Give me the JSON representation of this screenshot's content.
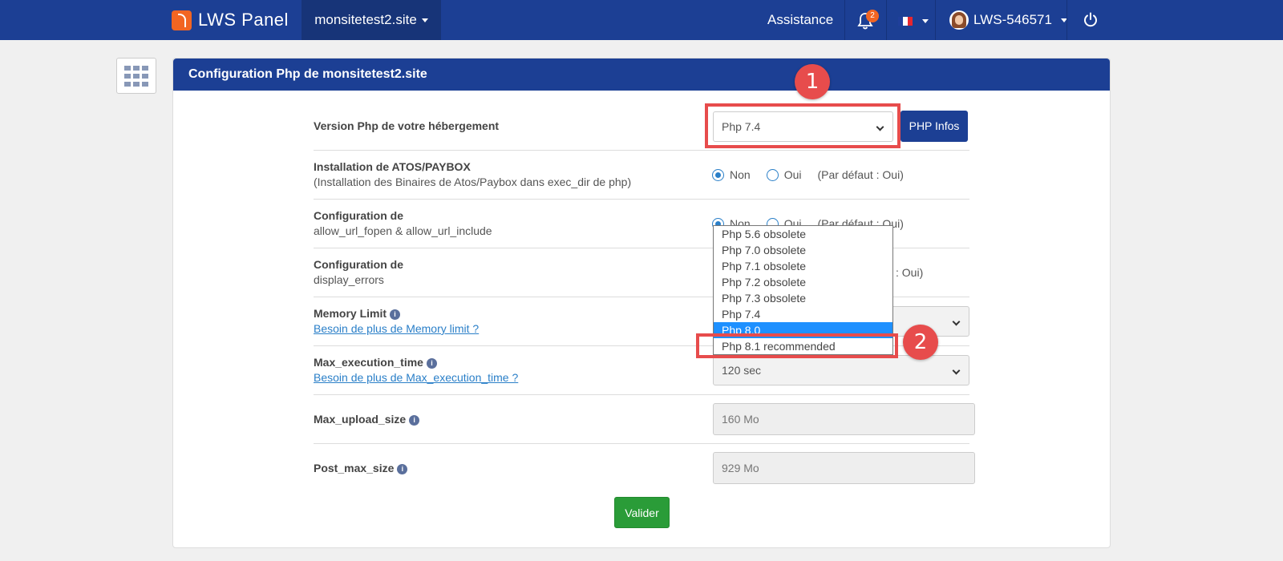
{
  "navbar": {
    "brand": "LWS Panel",
    "site": "monsitetest2.site",
    "assistance": "Assistance",
    "notifications_count": "2",
    "user": "LWS-546571",
    "flag_colors": [
      "#1f3f9b",
      "#ffffff",
      "#e8262f"
    ]
  },
  "panel": {
    "title": "Configuration Php de monsitetest2.site"
  },
  "rows": {
    "php_version": {
      "label": "Version Php de votre hébergement",
      "value": "Php 7.4",
      "button": "PHP Infos"
    },
    "atos": {
      "label": "Installation de ATOS/PAYBOX",
      "sub": "(Installation des Binaires de Atos/Paybox dans exec_dir de php)",
      "opt_non": "Non",
      "opt_oui": "Oui",
      "default": "(Par défaut : Oui)"
    },
    "allow_url": {
      "label": "Configuration de",
      "sub": "allow_url_fopen & allow_url_include",
      "opt_non": "Non",
      "opt_oui": "Oui",
      "default": "(Par défaut : Oui)"
    },
    "display_errors": {
      "label": "Configuration de",
      "sub": "display_errors",
      "default_tail": ": Oui)"
    },
    "memory_limit": {
      "label": "Memory Limit",
      "link": "Besoin de plus de Memory limit ?"
    },
    "max_execution": {
      "label": "Max_execution_time",
      "link": "Besoin de plus de Max_execution_time ?",
      "value": "120 sec"
    },
    "max_upload": {
      "label": "Max_upload_size",
      "value": "160 Mo"
    },
    "post_max": {
      "label": "Post_max_size",
      "value": "929 Mo"
    }
  },
  "dropdown": {
    "options": [
      "Php 5.6 obsolete",
      "Php 7.0 obsolete",
      "Php 7.1 obsolete",
      "Php 7.2 obsolete",
      "Php 7.3 obsolete",
      "Php 7.4",
      "Php 8.0",
      "Php 8.1 recommended"
    ],
    "highlighted_index": 6
  },
  "submit": "Valider",
  "annotations": {
    "one": "1",
    "two": "2",
    "color": "#e74c4c"
  }
}
